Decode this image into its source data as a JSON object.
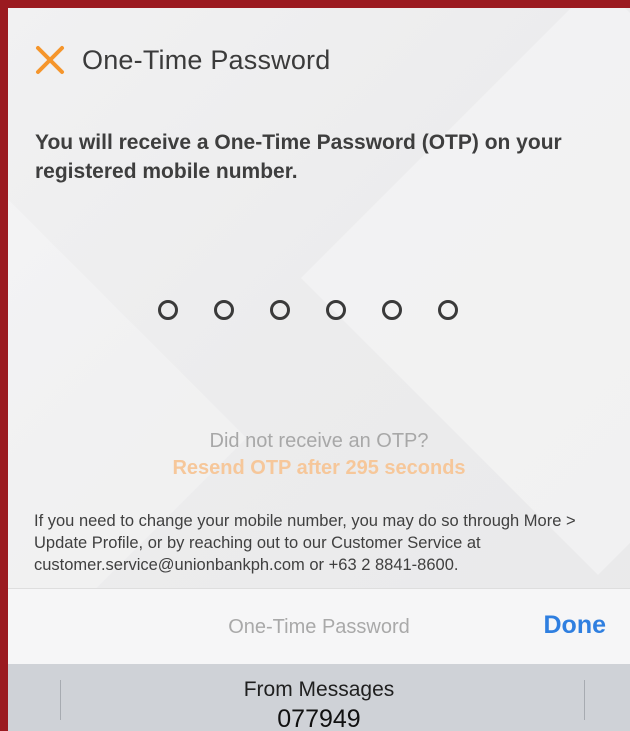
{
  "header": {
    "title": "One-Time Password",
    "close_icon": "close-icon",
    "close_color": "#f5952b"
  },
  "intro": "You will receive a One-Time Password (OTP) on your registered mobile number.",
  "otp": {
    "length": 6,
    "filled": 0
  },
  "resend": {
    "prompt": "Did not receive an OTP?",
    "link": "Resend OTP after 295 seconds"
  },
  "info": "If you need to change your mobile number, you may do so through More > Update Profile, or by reaching out to our Customer Service at customer.service@unionbankph.com or +63 2 8841-8600.",
  "toolbar": {
    "title": "One-Time Password",
    "done_label": "Done",
    "done_color": "#2f7fe0"
  },
  "suggestion": {
    "label": "From Messages",
    "code": "077949"
  }
}
